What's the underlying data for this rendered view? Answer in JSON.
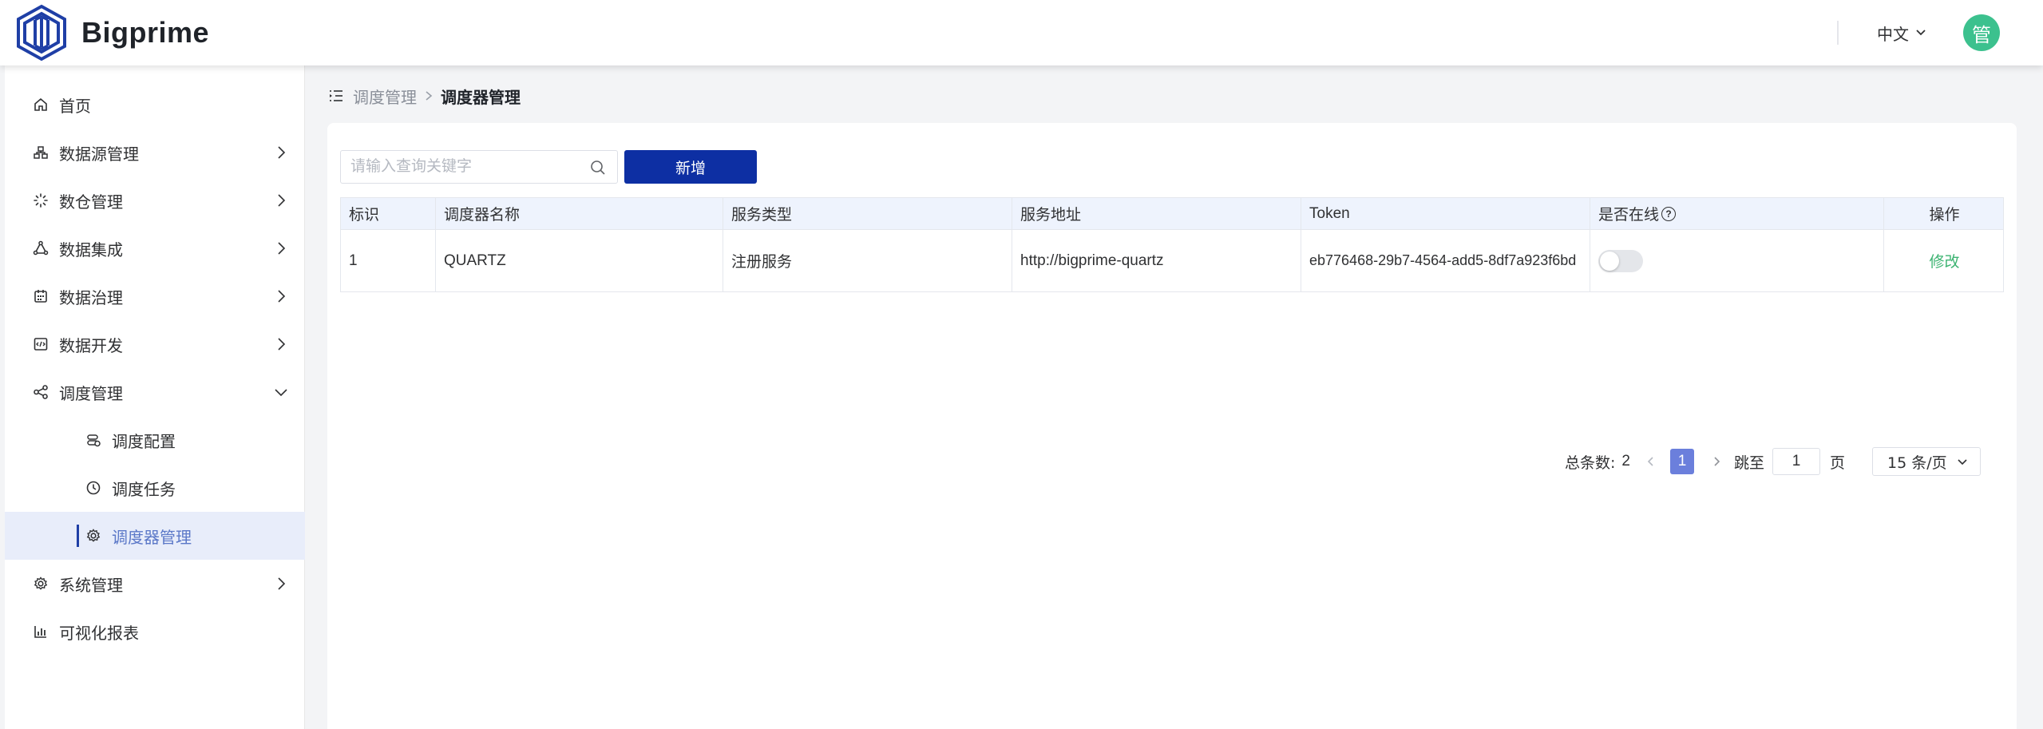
{
  "header": {
    "brand": "Bigprime",
    "language": "中文",
    "avatar_text": "管",
    "avatar_color": "#3cc18e"
  },
  "sidebar": {
    "items": [
      {
        "label": "首页",
        "icon": "home-icon",
        "has_arrow": false
      },
      {
        "label": "数据源管理",
        "icon": "datasource-icon",
        "has_arrow": true
      },
      {
        "label": "数仓管理",
        "icon": "warehouse-icon",
        "has_arrow": true
      },
      {
        "label": "数据集成",
        "icon": "integration-icon",
        "has_arrow": true
      },
      {
        "label": "数据治理",
        "icon": "governance-icon",
        "has_arrow": true
      },
      {
        "label": "数据开发",
        "icon": "code-icon",
        "has_arrow": true
      },
      {
        "label": "调度管理",
        "icon": "share-icon",
        "has_arrow": true,
        "expanded": true
      },
      {
        "label": "系统管理",
        "icon": "gear-icon",
        "has_arrow": true
      },
      {
        "label": "可视化报表",
        "icon": "bar-chart-icon",
        "has_arrow": false
      }
    ],
    "sub_items": [
      {
        "label": "调度配置",
        "icon": "config-icon"
      },
      {
        "label": "调度任务",
        "icon": "clock-icon"
      },
      {
        "label": "调度器管理",
        "icon": "gear-icon",
        "active": true
      }
    ]
  },
  "breadcrumb": {
    "parent": "调度管理",
    "current": "调度器管理"
  },
  "toolbar": {
    "search_placeholder": "请输入查询关键字",
    "add_label": "新增"
  },
  "table": {
    "columns": [
      "标识",
      "调度器名称",
      "服务类型",
      "服务地址",
      "Token",
      "是否在线",
      "操作"
    ],
    "rows": [
      {
        "id": "1",
        "name": "QUARTZ",
        "service_type": "注册服务",
        "address": "http://bigprime-quartz",
        "token": "eb776468-29b7-4564-add5-8df7a923f6bd",
        "online": false,
        "action": "修改"
      }
    ]
  },
  "pagination": {
    "total_label": "总条数:",
    "total": "2",
    "current_page": "1",
    "jump_label": "跳至",
    "jump_value": "1",
    "page_unit": "页",
    "page_size": "15 条/页"
  },
  "colors": {
    "primary": "#0d2fa3",
    "active_menu_bg": "#e8edfa",
    "link_green": "#3cb371",
    "page_active": "#6b7fdc"
  }
}
